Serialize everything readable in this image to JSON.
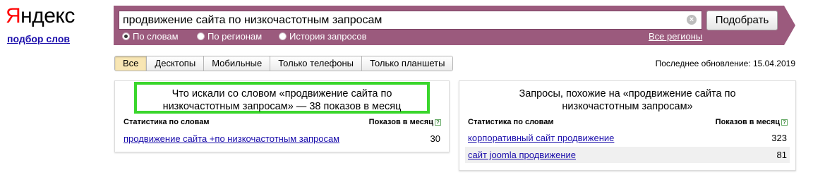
{
  "logo": {
    "first_letter": "Я",
    "rest": "ндекс"
  },
  "subtitle": "подбор слов",
  "search": {
    "value": "продвижение сайта по низкочастотным запросам",
    "clear_icon": "clear-icon",
    "submit_label": "Подобрать"
  },
  "modes": [
    {
      "label": "По словам",
      "selected": true
    },
    {
      "label": "По регионам",
      "selected": false
    },
    {
      "label": "История запросов",
      "selected": false
    }
  ],
  "all_regions": "Все регионы",
  "tabs": [
    {
      "label": "Все",
      "active": true
    },
    {
      "label": "Десктопы",
      "active": false
    },
    {
      "label": "Мобильные",
      "active": false
    },
    {
      "label": "Только телефоны",
      "active": false
    },
    {
      "label": "Только планшеты",
      "active": false
    }
  ],
  "last_update": "Последнее обновление: 15.04.2019",
  "left_panel": {
    "title_line1": "Что искали со словом «продвижение сайта по",
    "title_line2": "низкочастотным запросам» — 38 показов в месяц",
    "col_phrase": "Статистика по словам",
    "col_count": "Показов в месяц",
    "help_icon": "?",
    "rows": [
      {
        "phrase": "продвижение сайта +по низкочастотным запросам",
        "count": "30"
      }
    ]
  },
  "right_panel": {
    "title_line1": "Запросы, похожие на «продвижение сайта по",
    "title_line2": "низкочастотным запросам»",
    "col_phrase": "Статистика по словам",
    "col_count": "Показов в месяц",
    "help_icon": "?",
    "rows": [
      {
        "phrase": "корпоративный сайт продвижение",
        "count": "323"
      },
      {
        "phrase": "сайт joomla продвижение",
        "count": "81"
      }
    ]
  },
  "colors": {
    "accent": "#9b5a7d",
    "link": "#1a0dab",
    "highlight": "#3ad62c",
    "logo_red": "#ff0000"
  }
}
